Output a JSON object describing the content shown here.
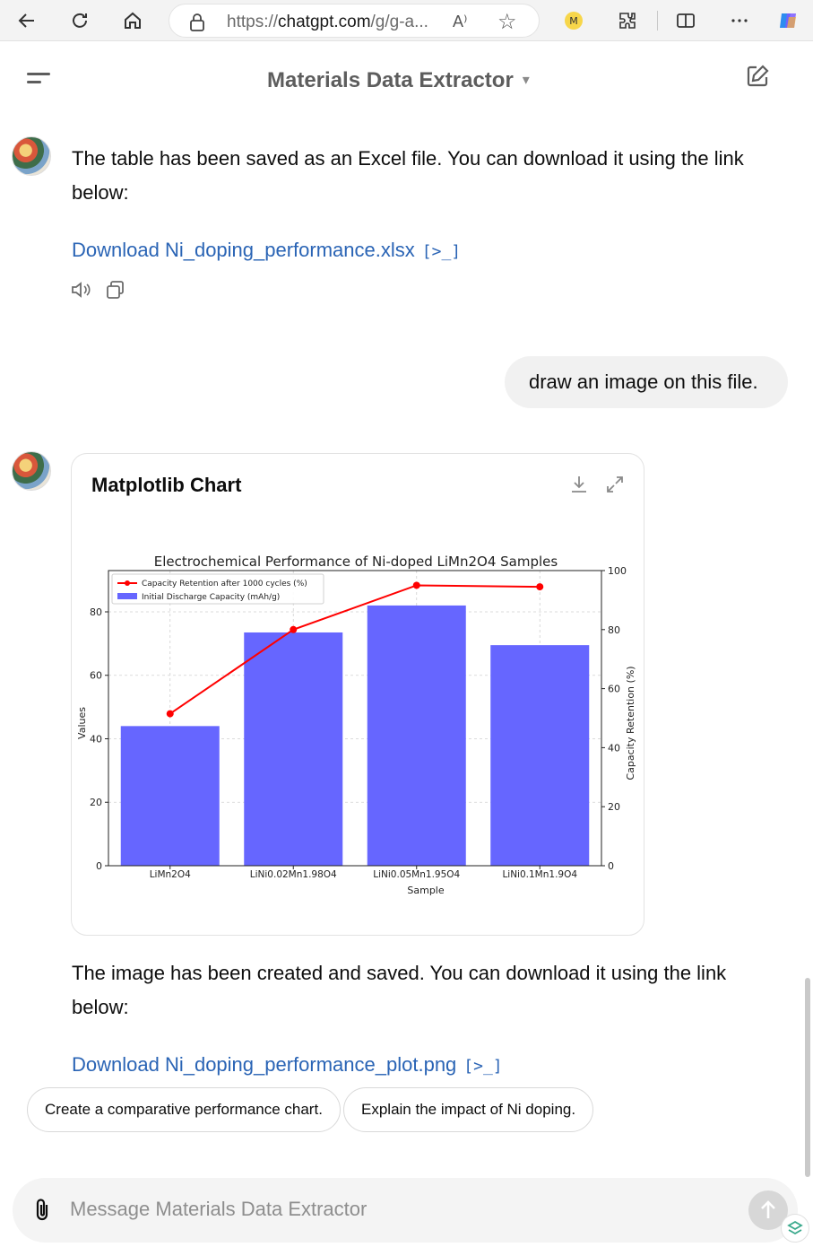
{
  "browser": {
    "url_prefix": "https://",
    "url_domain": "chatgpt.com",
    "url_rest": "/g/g-a...",
    "read_aloud_label": "A⁾"
  },
  "header": {
    "title": "Materials Data Extractor"
  },
  "messages": {
    "assistant_1_text": "The table has been saved as an Excel file. You can download it using the link below:",
    "assistant_1_link": "Download Ni_doping_performance.xlsx",
    "user_text": "draw an image on this file.",
    "chart_card_title": "Matplotlib Chart",
    "assistant_2_text": "The image has been created and saved. You can download it using the link below:",
    "assistant_2_link": "Download Ni_doping_performance_plot.png",
    "link_code_glyph": "[>_]"
  },
  "suggestions": [
    "Create a comparative performance chart.",
    "Explain the impact of Ni doping."
  ],
  "composer": {
    "placeholder": "Message Materials Data Extractor"
  },
  "colors": {
    "bar": "#6666ff",
    "line": "#ff0000",
    "link": "#2a64b5"
  },
  "chart_data": {
    "type": "bar",
    "title": "Electrochemical Performance of Ni-doped LiMn2O4 Samples",
    "xlabel": "Sample",
    "ylabel": "Values",
    "y2label": "Capacity Retention (%)",
    "categories": [
      "LiMn2O4",
      "LiNi0.02Mn1.98O4",
      "LiNi0.05Mn1.95O4",
      "LiNi0.1Mn1.9O4"
    ],
    "series": [
      {
        "name": "Initial Discharge Capacity (mAh/g)",
        "type": "bar",
        "axis": "left",
        "values": [
          44,
          73.5,
          82,
          69.5
        ]
      },
      {
        "name": "Capacity Retention after 1000 cycles (%)",
        "type": "line",
        "axis": "right",
        "values": [
          51.5,
          80,
          95,
          94.5
        ]
      }
    ],
    "ylim": [
      0,
      93
    ],
    "y2lim": [
      0,
      100
    ],
    "yticks": [
      0,
      20,
      40,
      60,
      80
    ],
    "y2ticks": [
      0,
      20,
      40,
      60,
      80,
      100
    ],
    "grid": true,
    "legend_position": "top-left"
  }
}
